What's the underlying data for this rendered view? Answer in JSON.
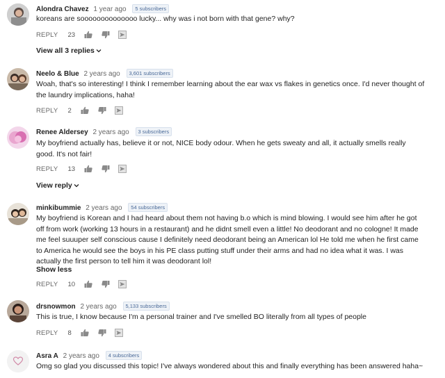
{
  "comments": [
    {
      "author": "Alondra Chavez",
      "age": "1 year ago",
      "subscribers": "5 subscribers",
      "text": "koreans are soooooooooooooo lucky... why was i not born with that gene?  why?",
      "reply_label": "REPLY",
      "likes": "23",
      "thread_link": "View all 3 replies"
    },
    {
      "author": "Neelo & Blue",
      "age": "2 years ago",
      "subscribers": "3,601 subscribers",
      "text": "Woah, that's so interesting! I think I remember learning about the ear wax vs flakes in genetics once. I'd never thought of the laundry implications, haha!",
      "reply_label": "REPLY",
      "likes": "2"
    },
    {
      "author": "Renee Aldersey",
      "age": "2 years ago",
      "subscribers": "3 subscribers",
      "text": "My boyfriend actually has, believe it or not, NICE body odour. When he gets sweaty and all, it actually smells really good. It's not fair!",
      "reply_label": "REPLY",
      "likes": "13",
      "thread_link": "View reply"
    },
    {
      "author": "minkibummie",
      "age": "2 years ago",
      "subscribers": "54 subscribers",
      "text": "My boyfriend is Korean and I had heard about them not having b.o which is mind blowing. I would see him after he got off from work (working 13 hours in a restaurant) and he didnt smell even a little! No deodorant and no cologne! It made me feel suuuper self conscious cause I definitely need deodorant being an American lol He told me when he first came to America he would see the boys in his PE class putting stuff under their arms and had no idea what it was. I was actually the first person to tell him it was deodorant lol!",
      "show_less": "Show less",
      "reply_label": "REPLY",
      "likes": "10"
    },
    {
      "author": "drsnowmon",
      "age": "2 years ago",
      "subscribers": "5,133 subscribers",
      "text": "This is true, I know because I'm a personal trainer and I've smelled BO literally from all types of people",
      "reply_label": "REPLY",
      "likes": "8"
    },
    {
      "author": "Asra A",
      "age": "2 years ago",
      "subscribers": "4 subscribers",
      "text": "Omg so glad you discussed this topic! I've always wondered about this and finally everything has been answered haha~"
    }
  ],
  "colors": {
    "subs_badge_bg": "#eef2f7",
    "subs_badge_text": "#4a6a98",
    "icon_gray": "#8a8a8a"
  }
}
